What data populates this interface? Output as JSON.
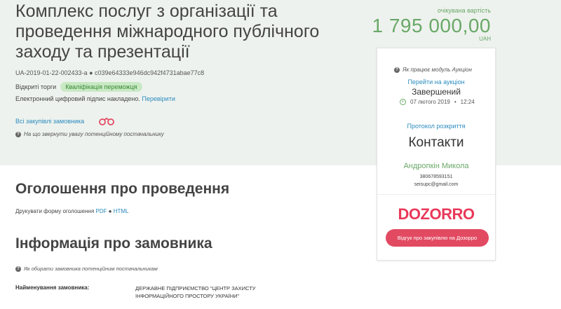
{
  "tender": {
    "title": "Комплекс послуг з організації та проведення міжнародного публічного заходу та презентації",
    "id_line": "UA-2019-01-22-002433-a ● c039e64333e946dc942f4731abae77c8",
    "status": "Відкриті торги",
    "badge": "Кваліфікація переможця",
    "signature_text": "Електронний цифровий підпис накладено.",
    "signature_link": "Перевірити",
    "all_purchases_link": "Всі закупівлі замовника",
    "supplier_hint": "На що звернути увагу потенційному постачальнику"
  },
  "price": {
    "label": "очікувана вартість",
    "amount": "1 795 000,00",
    "currency": "UAH"
  },
  "sidebar": {
    "auction_hint": "Як працює модуль Аукціон",
    "auction_link": "Перейти на аукціон",
    "auction_status": "Завершений",
    "auction_date": "07 лютого 2019",
    "auction_time": "12:24",
    "protocol_link": "Протокол розкриття",
    "contacts_title": "Контакти",
    "contact_name": "Андропкін Микола",
    "contact_phone": "380678593151",
    "contact_email": "seisupc@gmail.com",
    "logo_text": "DOZORRO",
    "review_button": "Відгук про закупівлю на Дозорро"
  },
  "announcement": {
    "title": "Оголошення про проведення",
    "print_label": "Друкувати форму оголошення",
    "pdf_link": "PDF",
    "separator": "●",
    "html_link": "HTML"
  },
  "customer": {
    "title": "Інформація про замовника",
    "hint": "Як обирати замовника потенційним постачальникам",
    "name_label": "Найменування замовника:",
    "name_value": "ДЕРЖАВНЕ ПІДПРИЄМСТВО \"ЦЕНТР ЗАХИСТУ ІНФОРМАЦІЙНОГО ПРОСТОРУ УКРАЇНИ\""
  },
  "colors": {
    "accent_green": "#6aa868",
    "link_blue": "#2b8bbf",
    "dozorro_red": "#e9395a",
    "hero_bg": "#eef2ee"
  }
}
